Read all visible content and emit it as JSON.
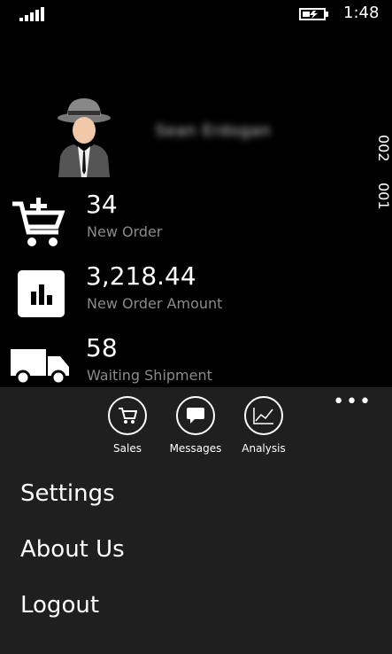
{
  "status_bar": {
    "time": "1:48"
  },
  "profile": {
    "user_name": "Sean Erdogan"
  },
  "pivot": {
    "headers": [
      "002",
      "001"
    ]
  },
  "stats": [
    {
      "value": "34",
      "label": "New Order",
      "icon": "cart-add-icon"
    },
    {
      "value": "3,218.44",
      "label": "New Order Amount",
      "icon": "bar-chart-icon"
    },
    {
      "value": "58",
      "label": "Waiting Shipment",
      "icon": "truck-icon"
    }
  ],
  "appbar": {
    "more": "•••",
    "buttons": [
      {
        "label": "Sales",
        "icon": "cart-icon"
      },
      {
        "label": "Messages",
        "icon": "message-icon"
      },
      {
        "label": "Analysis",
        "icon": "line-chart-icon"
      }
    ],
    "menu": [
      "Settings",
      "About Us",
      "Logout"
    ]
  }
}
